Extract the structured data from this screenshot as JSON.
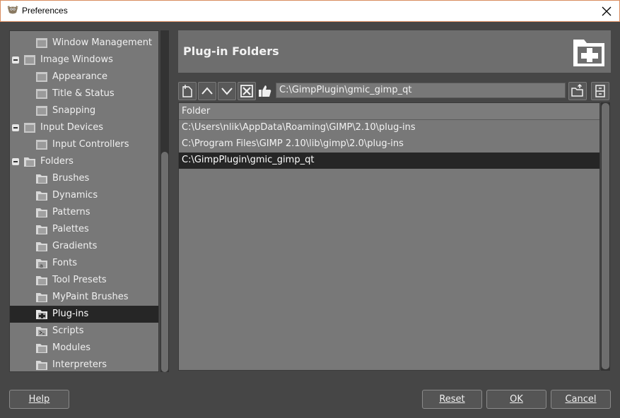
{
  "window": {
    "title": "Preferences"
  },
  "tree": {
    "items": [
      {
        "label": "Window Management",
        "level": 2,
        "icon": "window-management-icon",
        "expanded": null,
        "selected": false
      },
      {
        "label": "Image Windows",
        "level": 1,
        "icon": "image-windows-icon",
        "expanded": true,
        "selected": false
      },
      {
        "label": "Appearance",
        "level": 2,
        "icon": "appearance-icon",
        "expanded": null,
        "selected": false
      },
      {
        "label": "Title & Status",
        "level": 2,
        "icon": "title-status-icon",
        "expanded": null,
        "selected": false
      },
      {
        "label": "Snapping",
        "level": 2,
        "icon": "snapping-icon",
        "expanded": null,
        "selected": false
      },
      {
        "label": "Input Devices",
        "level": 1,
        "icon": "input-devices-icon",
        "expanded": true,
        "selected": false
      },
      {
        "label": "Input Controllers",
        "level": 2,
        "icon": "input-controllers-icon",
        "expanded": null,
        "selected": false
      },
      {
        "label": "Folders",
        "level": 1,
        "icon": "folders-icon",
        "expanded": true,
        "selected": false
      },
      {
        "label": "Brushes",
        "level": 2,
        "icon": "brushes-folder-icon",
        "expanded": null,
        "selected": false
      },
      {
        "label": "Dynamics",
        "level": 2,
        "icon": "dynamics-folder-icon",
        "expanded": null,
        "selected": false
      },
      {
        "label": "Patterns",
        "level": 2,
        "icon": "patterns-folder-icon",
        "expanded": null,
        "selected": false
      },
      {
        "label": "Palettes",
        "level": 2,
        "icon": "palettes-folder-icon",
        "expanded": null,
        "selected": false
      },
      {
        "label": "Gradients",
        "level": 2,
        "icon": "gradients-folder-icon",
        "expanded": null,
        "selected": false
      },
      {
        "label": "Fonts",
        "level": 2,
        "icon": "fonts-folder-icon",
        "expanded": null,
        "selected": false
      },
      {
        "label": "Tool Presets",
        "level": 2,
        "icon": "tool-presets-folder-icon",
        "expanded": null,
        "selected": false
      },
      {
        "label": "MyPaint Brushes",
        "level": 2,
        "icon": "mypaint-brushes-folder-icon",
        "expanded": null,
        "selected": false
      },
      {
        "label": "Plug-ins",
        "level": 2,
        "icon": "plugins-folder-icon",
        "expanded": null,
        "selected": true
      },
      {
        "label": "Scripts",
        "level": 2,
        "icon": "scripts-folder-icon",
        "expanded": null,
        "selected": false
      },
      {
        "label": "Modules",
        "level": 2,
        "icon": "modules-folder-icon",
        "expanded": null,
        "selected": false
      },
      {
        "label": "Interpreters",
        "level": 2,
        "icon": "interpreters-folder-icon",
        "expanded": null,
        "selected": false
      }
    ]
  },
  "panel": {
    "title": "Plug-in Folders",
    "header_icon": "plugin-folder-icon",
    "toolbar": {
      "buttons": [
        "new-folder-icon",
        "move-up-icon",
        "move-down-icon",
        "delete-icon",
        "thumbs-up-icon"
      ],
      "path_value": "C:\\GimpPlugin\\gmic_gimp_qt",
      "browse_icon": "browse-folder-icon",
      "toggle_icon": "file-cabinet-icon"
    },
    "list": {
      "column": "Folder",
      "rows": [
        {
          "path": "C:\\Users\\nlik\\AppData\\Roaming\\GIMP\\2.10\\plug-ins",
          "selected": false
        },
        {
          "path": "C:\\Program Files\\GIMP 2.10\\lib\\gimp\\2.0\\plug-ins",
          "selected": false
        },
        {
          "path": "C:\\GimpPlugin\\gmic_gimp_qt",
          "selected": true
        }
      ]
    }
  },
  "buttons": {
    "help": "Help",
    "reset": "Reset",
    "ok": "OK",
    "cancel": "Cancel"
  },
  "colors": {
    "background": "#464646",
    "tree_bg": "#787878",
    "selected": "#262626",
    "header_bg": "#6e6e6e"
  }
}
